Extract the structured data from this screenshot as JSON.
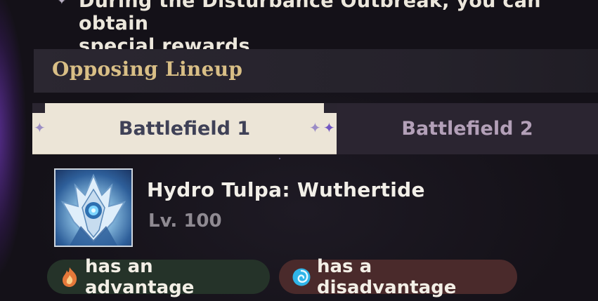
{
  "intro": {
    "line_1": "During the Disturbance Outbreak, you can obtain",
    "line_2": "special rewards"
  },
  "lineup": {
    "title": "Opposing Lineup"
  },
  "tabs": [
    {
      "label": "Battlefield 1",
      "active": true
    },
    {
      "label": "Battlefield 2",
      "active": false
    }
  ],
  "enemy": {
    "name": "Hydro Tulpa: Wuthertide",
    "level": "Lv. 100",
    "portrait_icon": "hydro-tulpa-portrait"
  },
  "elements": {
    "advantage": {
      "icon": "pyro-icon",
      "label": "has an advantage",
      "color": "#e5783a"
    },
    "disadvantage": {
      "icon": "hydro-icon",
      "label": "has a disadvantage",
      "color": "#2fb4e8"
    }
  }
}
